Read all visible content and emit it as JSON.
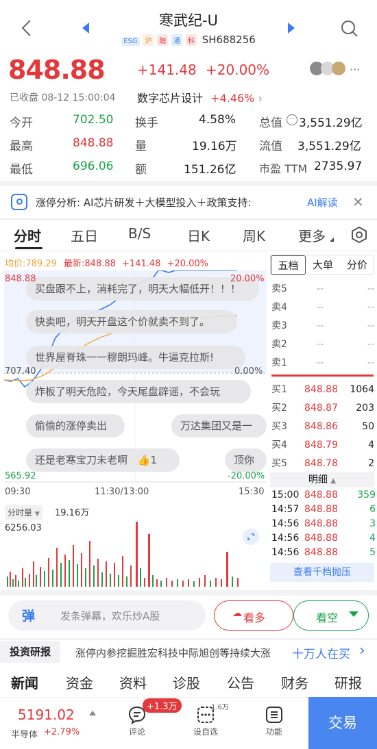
{
  "header": {
    "title": "寒武纪-U",
    "tags": [
      "ESG",
      "沪",
      "融",
      "通",
      "科"
    ],
    "code": "SH688256"
  },
  "quote": {
    "price": "848.88",
    "change": "+141.48",
    "change_pct": "+20.00%",
    "status": "已收盘 08-12 15:00:04",
    "sector": "数字芯片设计",
    "sector_pct": "+4.46%"
  },
  "stats": {
    "open_label": "今开",
    "open": "702.50",
    "high_label": "最高",
    "high": "848.88",
    "low_label": "最低",
    "low": "696.06",
    "turnover_label": "换手",
    "turnover": "4.58%",
    "volume_label": "量",
    "volume": "19.16万",
    "amount_label": "额",
    "amount": "151.26亿",
    "mktcap_label": "总值",
    "mktcap": "3,551.29亿",
    "float_label": "流值",
    "float": "3,551.29亿",
    "pe_label": "市盈 TTM",
    "pe": "2735.97"
  },
  "banner": {
    "text": "涨停分析: AI芯片研发＋大模型投入＋政策支持:",
    "action": "AI解读"
  },
  "tabs": [
    "分时",
    "五日",
    "B/S",
    "日K",
    "周K",
    "更多"
  ],
  "intraday": {
    "avg_label": "均价:789.29",
    "latest_label": "最新:848.88",
    "change": "+141.48",
    "change_pct": "+20.00%",
    "y_top": "848.88",
    "y_top_pct": "20.00%",
    "y_mid": "707.40",
    "y_mid_pct": "0.00%",
    "y_bottom": "565.92",
    "y_bottom_pct": "-20.00%",
    "time_start": "09:30",
    "time_mid": "11:30/13:00",
    "time_end": "15:30",
    "vol_selector": "分时量",
    "vol_total": "19.16万",
    "vol_max": "6256.03"
  },
  "danmu": [
    "买盘跟不上，消耗完了，明天大幅低开！！！",
    "快卖吧，明天开盘这个价就卖不到了。",
    "世界屋脊珠一一穆朗玛峰。牛逼克拉斯!",
    "炸板了明天危险，今天尾盘辟谣，不会玩",
    "偷偷的涨停卖出",
    "万达集团又是一",
    "还是老寒宝刀未老啊",
    "1",
    "顶你"
  ],
  "orderbook": {
    "tabs": [
      "五档",
      "大单",
      "分价"
    ],
    "asks": [
      {
        "label": "卖5",
        "price": "--",
        "vol": "--"
      },
      {
        "label": "卖4",
        "price": "--",
        "vol": "--"
      },
      {
        "label": "卖3",
        "price": "--",
        "vol": "--"
      },
      {
        "label": "卖2",
        "price": "--",
        "vol": "--"
      },
      {
        "label": "卖1",
        "price": "--",
        "vol": "--"
      }
    ],
    "bids": [
      {
        "label": "买1",
        "price": "848.88",
        "vol": "1064"
      },
      {
        "label": "买2",
        "price": "848.87",
        "vol": "203"
      },
      {
        "label": "买3",
        "price": "848.86",
        "vol": "50"
      },
      {
        "label": "买4",
        "price": "848.79",
        "vol": "4"
      },
      {
        "label": "买5",
        "price": "848.78",
        "vol": "2"
      }
    ],
    "detail_label": "明细",
    "details": [
      {
        "time": "15:00",
        "price": "848.88",
        "vol": "359"
      },
      {
        "time": "14:57",
        "price": "848.88",
        "vol": "6"
      },
      {
        "time": "14:56",
        "price": "848.88",
        "vol": "3"
      },
      {
        "time": "14:56",
        "price": "848.88",
        "vol": "4"
      },
      {
        "time": "14:56",
        "price": "848.88",
        "vol": "5"
      }
    ],
    "more_button": "查看千档抛压"
  },
  "comment_bar": {
    "placeholder": "发条弹幕，欢乐炒A股",
    "bull": "看多",
    "bear": "看空"
  },
  "research": {
    "label": "投资研报",
    "headline": "涨停内参挖掘胜宏科技中际旭创等持续大涨",
    "hot": "十万人在买"
  },
  "bottom_tabs": [
    "新闻",
    "资金",
    "资料",
    "诊股",
    "公告",
    "财务",
    "研报"
  ],
  "footer": {
    "index_value": "5191.02",
    "index_name": "半导体",
    "index_pct": "+2.79%",
    "comment_label": "评论",
    "comment_badge": "+1.3万",
    "watch_label": "设自选",
    "watch_count": "1.6万",
    "func_label": "功能",
    "trade_label": "交易"
  },
  "colors": {
    "up": "#e4393c",
    "down": "#1aa34a",
    "accent": "#3a7bf0",
    "price_line": "#3a7bf0",
    "avg_line": "#f0a53a"
  }
}
